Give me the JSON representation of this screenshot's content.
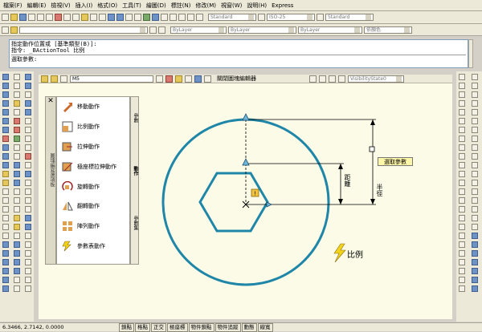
{
  "menu": [
    "檔案(F)",
    "編輯(E)",
    "檢視(V)",
    "插入(I)",
    "格式(O)",
    "工具(T)",
    "繪圖(D)",
    "標註(N)",
    "修改(M)",
    "視窗(W)",
    "說明(H)",
    "Express"
  ],
  "toolbar": {
    "textstyle": "Standard",
    "dimstyle": "ISO-25",
    "tablestyle": "Standard",
    "layer_color": "ByLayer",
    "linetype": "ByLayer",
    "lineweight": "ByLayer",
    "plotstyle": "依顏色"
  },
  "command": {
    "line1": "指定動作位置或 [基準類型(B)]:",
    "line2": "指令: _BActionTool 比例",
    "prompt": "選取參數:"
  },
  "block_editor": {
    "block_name": "M5",
    "close_label": "關閉圖塊編輯器",
    "visibility": "VisibilityState0"
  },
  "palette": {
    "title": "圖塊編寫選項板",
    "items": [
      "移動動作",
      "比例動作",
      "拉伸動作",
      "極座標拉伸動作",
      "旋轉動作",
      "翻轉動作",
      "陣列動作",
      "參數表動作"
    ],
    "tabs": [
      "參數",
      "動作",
      "參數集"
    ]
  },
  "drawing": {
    "radius_label": "半徑",
    "distance_label": "距離",
    "tooltip": "選取參數",
    "action_label": "比例"
  },
  "status": {
    "coords": "6.3466, 2.7142, 0.0000",
    "buttons": [
      "鎖點",
      "格點",
      "正交",
      "極座標",
      "物件鎖點",
      "物件追蹤",
      "動態",
      "線寬"
    ]
  },
  "colors": {
    "shape": "#1f86a8",
    "canvas": "#fbfbe8",
    "tooltip": "#fff7a8"
  }
}
